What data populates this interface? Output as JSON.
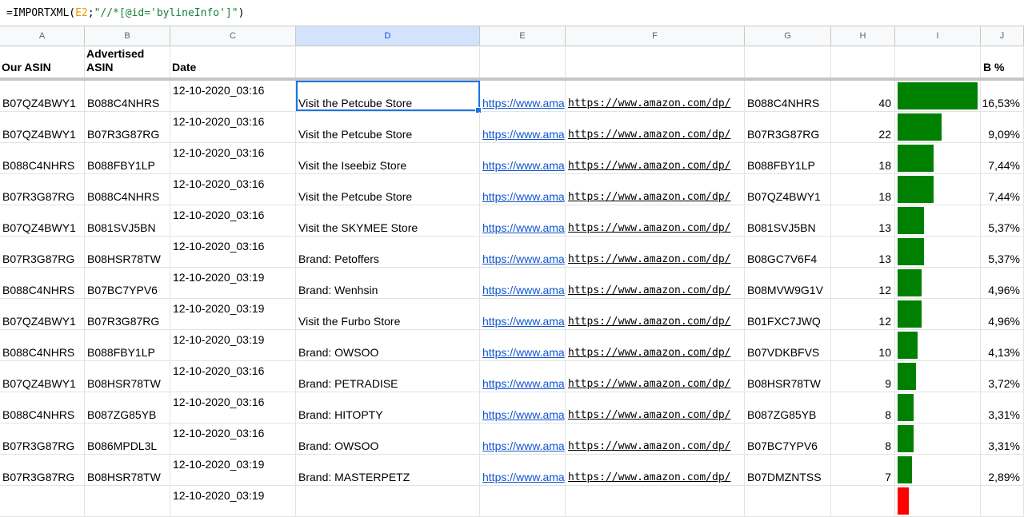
{
  "formula_bar": {
    "prefix": "=IMPORTXML(",
    "ref": "E2",
    "separator": ";",
    "string": "\"//*[@id='bylineInfo']\"",
    "suffix": ")"
  },
  "column_letters": [
    "A",
    "B",
    "C",
    "D",
    "E",
    "F",
    "G",
    "H",
    "I",
    "J"
  ],
  "headers": {
    "our_asin": "Our ASIN",
    "advertised_asin": "Advertised ASIN",
    "date": "Date",
    "b_percent": "B %"
  },
  "colors": {
    "bar_green": "#008000",
    "bar_red": "#ff0000",
    "link_blue": "#1155cc",
    "selection_blue": "#1a73e8"
  },
  "rows": [
    {
      "our": "B07QZ4BWY1",
      "adv": "B088C4NHRS",
      "date": "12-10-2020_03:16",
      "brand": "Visit the Petcube Store",
      "link_e": "https://www.ama",
      "link_f": "https://www.amazon.com/dp/",
      "asin": "B088C4NHRS",
      "count": "40",
      "bar_fraction": 1.0,
      "pct": "16,53%"
    },
    {
      "our": "B07QZ4BWY1",
      "adv": "B07R3G87RG",
      "date": "12-10-2020_03:16",
      "brand": "Visit the Petcube Store",
      "link_e": "https://www.ama",
      "link_f": "https://www.amazon.com/dp/",
      "asin": "B07R3G87RG",
      "count": "22",
      "bar_fraction": 0.55,
      "pct": "9,09%"
    },
    {
      "our": "B088C4NHRS",
      "adv": "B088FBY1LP",
      "date": "12-10-2020_03:16",
      "brand": "Visit the Iseebiz Store",
      "link_e": "https://www.ama",
      "link_f": "https://www.amazon.com/dp/",
      "asin": "B088FBY1LP",
      "count": "18",
      "bar_fraction": 0.45,
      "pct": "7,44%"
    },
    {
      "our": "B07R3G87RG",
      "adv": "B088C4NHRS",
      "date": "12-10-2020_03:16",
      "brand": "Visit the Petcube Store",
      "link_e": "https://www.ama",
      "link_f": "https://www.amazon.com/dp/",
      "asin": "B07QZ4BWY1",
      "count": "18",
      "bar_fraction": 0.45,
      "pct": "7,44%"
    },
    {
      "our": "B07QZ4BWY1",
      "adv": "B081SVJ5BN",
      "date": "12-10-2020_03:16",
      "brand": "Visit the SKYMEE Store",
      "link_e": "https://www.ama",
      "link_f": "https://www.amazon.com/dp/",
      "asin": "B081SVJ5BN",
      "count": "13",
      "bar_fraction": 0.325,
      "pct": "5,37%"
    },
    {
      "our": "B07R3G87RG",
      "adv": "B08HSR78TW",
      "date": "12-10-2020_03:16",
      "brand": "Brand: Petoffers",
      "link_e": "https://www.ama",
      "link_f": "https://www.amazon.com/dp/",
      "asin": "B08GC7V6F4",
      "count": "13",
      "bar_fraction": 0.325,
      "pct": "5,37%"
    },
    {
      "our": "B088C4NHRS",
      "adv": "B07BC7YPV6",
      "date": "12-10-2020_03:19",
      "brand": "Brand: Wenhsin",
      "link_e": "https://www.ama",
      "link_f": "https://www.amazon.com/dp/",
      "asin": "B08MVW9G1V",
      "count": "12",
      "bar_fraction": 0.3,
      "pct": "4,96%"
    },
    {
      "our": "B07QZ4BWY1",
      "adv": "B07R3G87RG",
      "date": "12-10-2020_03:19",
      "brand": "Visit the Furbo Store",
      "link_e": "https://www.ama",
      "link_f": "https://www.amazon.com/dp/",
      "asin": "B01FXC7JWQ",
      "count": "12",
      "bar_fraction": 0.3,
      "pct": "4,96%"
    },
    {
      "our": "B088C4NHRS",
      "adv": "B088FBY1LP",
      "date": "12-10-2020_03:19",
      "brand": "Brand: OWSOO",
      "link_e": "https://www.ama",
      "link_f": "https://www.amazon.com/dp/",
      "asin": "B07VDKBFVS",
      "count": "10",
      "bar_fraction": 0.25,
      "pct": "4,13%"
    },
    {
      "our": "B07QZ4BWY1",
      "adv": "B08HSR78TW",
      "date": "12-10-2020_03:16",
      "brand": "Brand: PETRADISE",
      "link_e": "https://www.ama",
      "link_f": "https://www.amazon.com/dp/",
      "asin": "B08HSR78TW",
      "count": "9",
      "bar_fraction": 0.225,
      "pct": "3,72%"
    },
    {
      "our": "B088C4NHRS",
      "adv": "B087ZG85YB",
      "date": "12-10-2020_03:16",
      "brand": "Brand: HITOPTY",
      "link_e": "https://www.ama",
      "link_f": "https://www.amazon.com/dp/",
      "asin": "B087ZG85YB",
      "count": "8",
      "bar_fraction": 0.2,
      "pct": "3,31%"
    },
    {
      "our": "B07R3G87RG",
      "adv": "B086MPDL3L",
      "date": "12-10-2020_03:16",
      "brand": "Brand: OWSOO",
      "link_e": "https://www.ama",
      "link_f": "https://www.amazon.com/dp/",
      "asin": "B07BC7YPV6",
      "count": "8",
      "bar_fraction": 0.2,
      "pct": "3,31%"
    },
    {
      "our": "B07R3G87RG",
      "adv": "B08HSR78TW",
      "date": "12-10-2020_03:19",
      "brand": "Brand: MASTERPETZ",
      "link_e": "https://www.ama",
      "link_f": "https://www.amazon.com/dp/",
      "asin": "B07DMZNTSS",
      "count": "7",
      "bar_fraction": 0.175,
      "pct": "2,89%"
    }
  ],
  "partial_row": {
    "date": "12-10-2020_03:19",
    "bar_color": "#ff0000"
  }
}
